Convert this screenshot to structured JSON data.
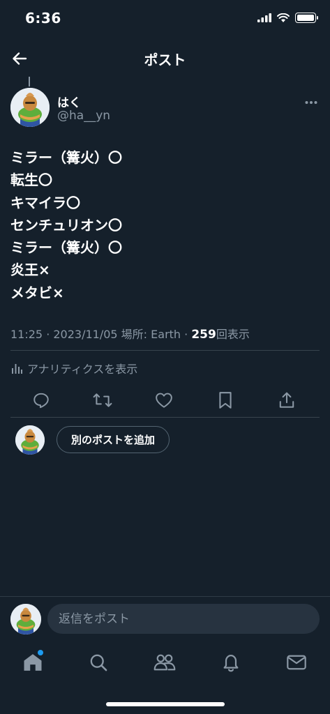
{
  "status_bar": {
    "time": "6:36"
  },
  "header": {
    "title": "ポスト"
  },
  "author": {
    "name": "はく",
    "handle": "@ha__yn"
  },
  "post": {
    "lines": [
      "ミラー（篝火）〇",
      "転生〇",
      "キマイラ〇",
      "センチュリオン〇",
      "ミラー（篝火）〇",
      "炎王×",
      "メタビ×"
    ],
    "meta_prefix": "11:25 · 2023/11/05 場所: Earth · ",
    "view_count": "259",
    "view_suffix": "回表示"
  },
  "analytics": {
    "label": "アナリティクスを表示"
  },
  "actions": {
    "icons": [
      "reply-icon",
      "repost-icon",
      "like-icon",
      "bookmark-icon",
      "share-icon"
    ]
  },
  "add_post": {
    "label": "別のポストを追加"
  },
  "reply": {
    "placeholder": "返信をポスト"
  },
  "bottom_nav": {
    "icons": [
      "home-icon",
      "search-icon",
      "communities-icon",
      "notifications-icon",
      "messages-icon"
    ],
    "notification_dot_on": "home"
  },
  "colors": {
    "background": "#15202b",
    "secondary_text": "#8b98a5",
    "accent": "#1d9bf0",
    "divider": "#38444d"
  }
}
